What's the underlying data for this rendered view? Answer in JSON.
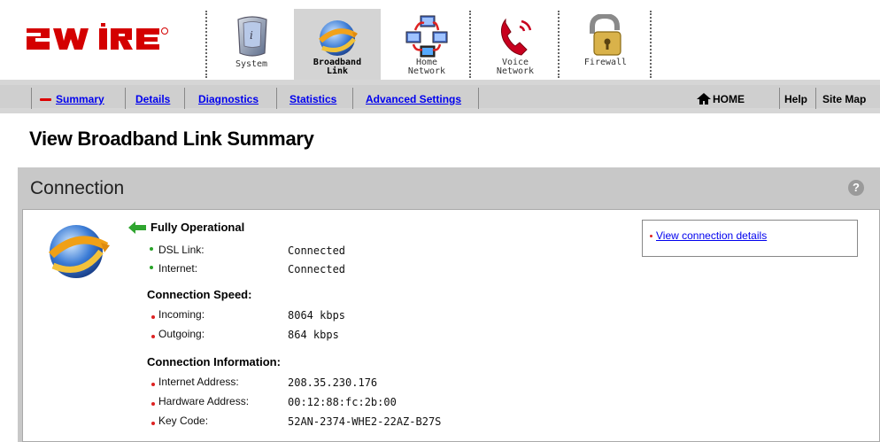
{
  "brand": {
    "logo_text": "2WIRE"
  },
  "tabs": [
    {
      "label_line1": "System",
      "label_line2": "",
      "icon": "system-icon"
    },
    {
      "label_line1": "Broadband",
      "label_line2": "Link",
      "icon": "broadband-globe-icon"
    },
    {
      "label_line1": "Home",
      "label_line2": "Network",
      "icon": "home-network-icon"
    },
    {
      "label_line1": "Voice",
      "label_line2": "Network",
      "icon": "phone-icon"
    },
    {
      "label_line1": "Firewall",
      "label_line2": "",
      "icon": "padlock-icon"
    }
  ],
  "subnav": {
    "items": [
      {
        "label": "Summary",
        "current": true
      },
      {
        "label": "Details"
      },
      {
        "label": "Diagnostics"
      },
      {
        "label": "Statistics"
      },
      {
        "label": "Advanced Settings"
      }
    ],
    "right": {
      "home": "HOME",
      "help": "Help",
      "sitemap": "Site Map"
    }
  },
  "page_title": "View Broadband Link Summary",
  "connection": {
    "heading": "Connection",
    "help_glyph": "?",
    "status": "Fully Operational",
    "dsl_label": "DSL Link:",
    "dsl_value": "Connected",
    "internet_label": "Internet:",
    "internet_value": "Connected",
    "speed_heading": "Connection Speed:",
    "incoming_label": "Incoming:",
    "incoming_value": "8064 kbps",
    "outgoing_label": "Outgoing:",
    "outgoing_value": "864 kbps",
    "info_heading": "Connection Information:",
    "ip_label": "Internet Address:",
    "ip_value": "208.35.230.176",
    "mac_label": "Hardware Address:",
    "mac_value": "00:12:88:fc:2b:00",
    "key_label": "Key Code:",
    "key_value": "52AN-2374-WHE2-22AZ-B27S",
    "details_link": "View connection details"
  },
  "colors": {
    "accent_red": "#dd0000",
    "link_blue": "#0000ee",
    "panel_gray": "#c8c8c8",
    "status_green": "#29a329"
  }
}
